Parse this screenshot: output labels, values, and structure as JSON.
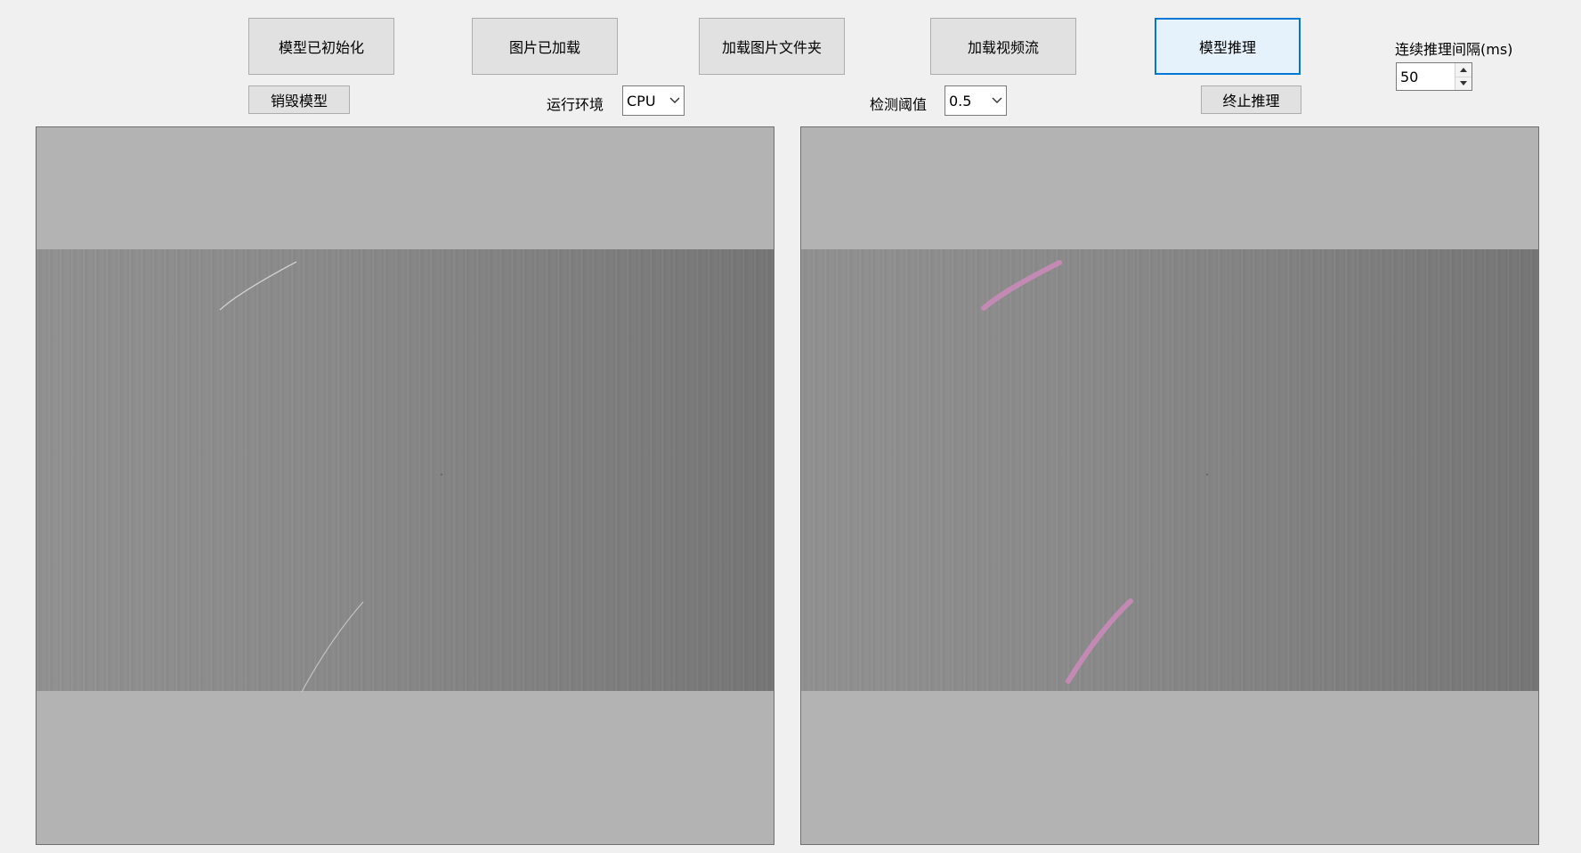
{
  "toolbar": {
    "model_initialized_label": "模型已初始化",
    "image_loaded_label": "图片已加载",
    "load_image_folder_label": "加载图片文件夹",
    "load_video_stream_label": "加载视频流",
    "model_inference_label": "模型推理",
    "destroy_model_label": "销毁模型",
    "stop_inference_label": "终止推理"
  },
  "settings": {
    "runtime_label": "运行环境",
    "runtime_value": "CPU",
    "threshold_label": "检测阈值",
    "threshold_value": "0.5",
    "interval_label": "连续推理间隔(ms)",
    "interval_value": "50"
  },
  "icons": {
    "dropdown": "chevron-down-icon",
    "spin_up": "arrow-up-icon",
    "spin_down": "arrow-down-icon"
  },
  "colors": {
    "accent": "#0078d7",
    "defect_mark": "#c98ab8",
    "scratch": "#d9d9d9"
  }
}
